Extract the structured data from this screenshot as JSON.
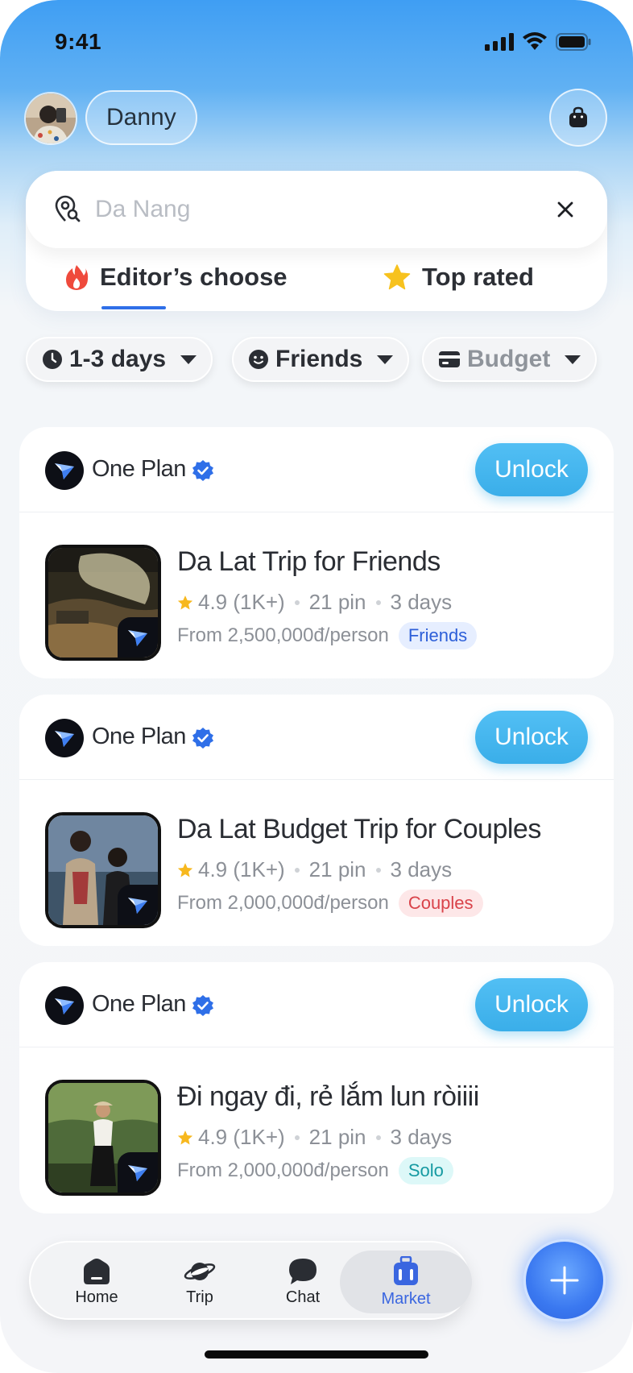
{
  "status_bar": {
    "time": "9:41"
  },
  "header": {
    "user_name": "Danny"
  },
  "search": {
    "value": "",
    "placeholder": "Da Nang"
  },
  "tabs": [
    {
      "label": "Editor’s choose",
      "icon": "fire-icon",
      "active": true
    },
    {
      "label": "Top rated",
      "icon": "star-icon",
      "active": false
    }
  ],
  "filters": [
    {
      "label": "1-3 days",
      "icon": "clock-icon"
    },
    {
      "label": "Friends",
      "icon": "smile-icon"
    },
    {
      "label": "Budget",
      "icon": "card-icon"
    }
  ],
  "trips": [
    {
      "brand": "One Plan",
      "unlock_label": "Unlock",
      "title": "Da Lat Trip for Friends",
      "rating": "4.9 (1K+)",
      "pins": "21 pin",
      "duration": "3 days",
      "price": "From 2,500,000đ/person",
      "tag": "Friends"
    },
    {
      "brand": "One Plan",
      "unlock_label": "Unlock",
      "title": "Da Lat Budget Trip for Couples",
      "rating": "4.9 (1K+)",
      "pins": "21 pin",
      "duration": "3 days",
      "price": "From 2,000,000đ/person",
      "tag": "Couples"
    },
    {
      "brand": "One Plan",
      "unlock_label": "Unlock",
      "title": "Đi ngay đi, rẻ lắm lun ròiiii",
      "rating": "4.9 (1K+)",
      "pins": "21 pin",
      "duration": "3 days",
      "price": "From 2,000,000đ/person",
      "tag": "Solo"
    }
  ],
  "nav": [
    {
      "label": "Home",
      "icon": "home-icon"
    },
    {
      "label": "Trip",
      "icon": "planet-icon"
    },
    {
      "label": "Chat",
      "icon": "chat-bubble-icon"
    },
    {
      "label": "Market",
      "icon": "luggage-icon",
      "active": true
    }
  ],
  "colors": {
    "accent": "#3aaee9",
    "active_nav": "#3a66e0",
    "underline": "#2f6fe8"
  }
}
